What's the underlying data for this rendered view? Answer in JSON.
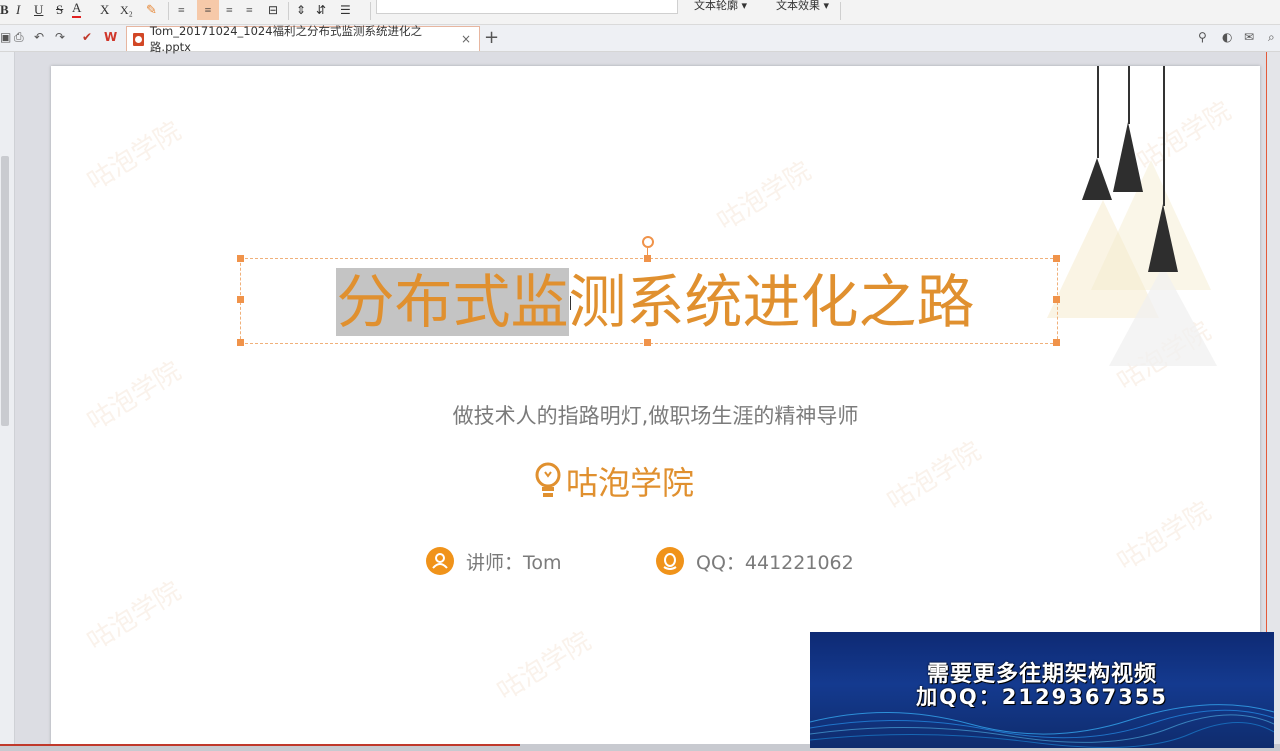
{
  "toolbar": {
    "font_buttons": [
      "B",
      "I",
      "U",
      "S",
      "A",
      "X",
      "X₂"
    ],
    "text_outline_label": "文本轮廓",
    "text_effect_label": "文本效果"
  },
  "tabs": {
    "doc_title": "Tom_20171024_1024福利之分布式监测系统进化之路.pptx",
    "close": "×",
    "add": "+"
  },
  "slide": {
    "title_selected": "分布式监",
    "title_rest": "测系统进化之路",
    "subtitle": "做技术人的指路明灯,做职场生涯的精神导师",
    "brand": "咕泡学院",
    "lecturer": "讲师：Tom",
    "qq": "QQ：441221062",
    "watermark": "咕泡学院"
  },
  "overlay_ad": {
    "line1": "需要更多往期架构视频",
    "line2": "加QQ：2129367355"
  },
  "colors": {
    "accent": "#e0902f",
    "selection": "#c4c4c4",
    "handle": "#f0934a",
    "ad_bg": "#0e2a74"
  },
  "icons": [
    "bold-icon",
    "italic-icon",
    "underline-icon",
    "strike-icon",
    "font-color-icon",
    "undo-icon",
    "redo-icon",
    "pptx-file-icon",
    "user-icon",
    "qq-icon",
    "bulb-logo-icon"
  ]
}
